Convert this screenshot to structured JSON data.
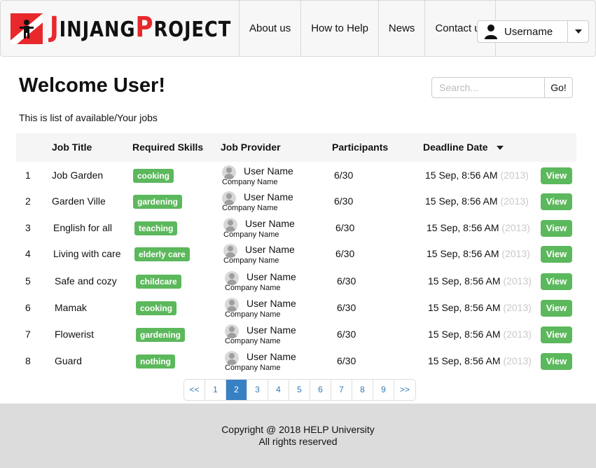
{
  "brand": {
    "name_first": "J",
    "name_rest1": "INJANG",
    "name_second": "P",
    "name_rest2": "ROJECT"
  },
  "nav": {
    "items": [
      "About us",
      "How to Help",
      "News",
      "Contact us"
    ],
    "username": "Username"
  },
  "header": {
    "title": "Welcome User!",
    "subtitle": "This is list of available/Your jobs"
  },
  "search": {
    "placeholder": "Search...",
    "button": "Go!"
  },
  "table": {
    "headers": {
      "job_title": "Job Title",
      "skills": "Required Skills",
      "provider": "Job Provider",
      "participants": "Participants",
      "deadline": "Deadline Date"
    },
    "rows": [
      {
        "num": "1",
        "title": "Job Garden",
        "skill": "cooking",
        "provider": "User Name",
        "company": "Company Name",
        "participants": "6/30",
        "date": "15 Sep, 8:56 AM",
        "year": "(2013)",
        "action": "View"
      },
      {
        "num": "2",
        "title": "Garden Ville",
        "skill": "gardening",
        "provider": "User Name",
        "company": "Company Name",
        "participants": "6/30",
        "date": "15 Sep, 8:56 AM",
        "year": "(2013)",
        "action": "View"
      },
      {
        "num": "3",
        "title": "English for all",
        "skill": "teaching",
        "provider": "User Name",
        "company": "Company Name",
        "participants": "6/30",
        "date": "15 Sep, 8:56 AM",
        "year": "(2013)",
        "action": "View"
      },
      {
        "num": "4",
        "title": "Living with care",
        "skill": "elderly care",
        "provider": "User Name",
        "company": "Company Name",
        "participants": "6/30",
        "date": "15 Sep, 8:56 AM",
        "year": "(2013)",
        "action": "View"
      },
      {
        "num": "5",
        "title": "Safe and cozy",
        "skill": "childcare",
        "provider": "User Name",
        "company": "Company Name",
        "participants": "6/30",
        "date": "15 Sep, 8:56 AM",
        "year": "(2013)",
        "action": "View"
      },
      {
        "num": "6",
        "title": "Mamak",
        "skill": "cooking",
        "provider": "User Name",
        "company": "Company Name",
        "participants": "6/30",
        "date": "15 Sep, 8:56 AM",
        "year": "(2013)",
        "action": "View"
      },
      {
        "num": "7",
        "title": "Flowerist",
        "skill": "gardening",
        "provider": "User Name",
        "company": "Company Name",
        "participants": "6/30",
        "date": "15 Sep, 8:56 AM",
        "year": "(2013)",
        "action": "View"
      },
      {
        "num": "8",
        "title": "Guard",
        "skill": "nothing",
        "provider": "User Name",
        "company": "Company Name",
        "participants": "6/30",
        "date": "15 Sep, 8:56 AM",
        "year": "(2013)",
        "action": "View"
      }
    ]
  },
  "pagination": {
    "prev": "<<",
    "pages": [
      "1",
      "2",
      "3",
      "4",
      "5",
      "6",
      "7",
      "8",
      "9"
    ],
    "active": "2",
    "next": ">>"
  },
  "footer": {
    "line1": "Copyright @ 2018 HELP University",
    "line2": "All rights reserved"
  },
  "colors": {
    "brand_red": "#e8282b",
    "badge_green": "#5cb85c",
    "page_active": "#3880c4",
    "footer_bg": "#dcdcdc"
  }
}
